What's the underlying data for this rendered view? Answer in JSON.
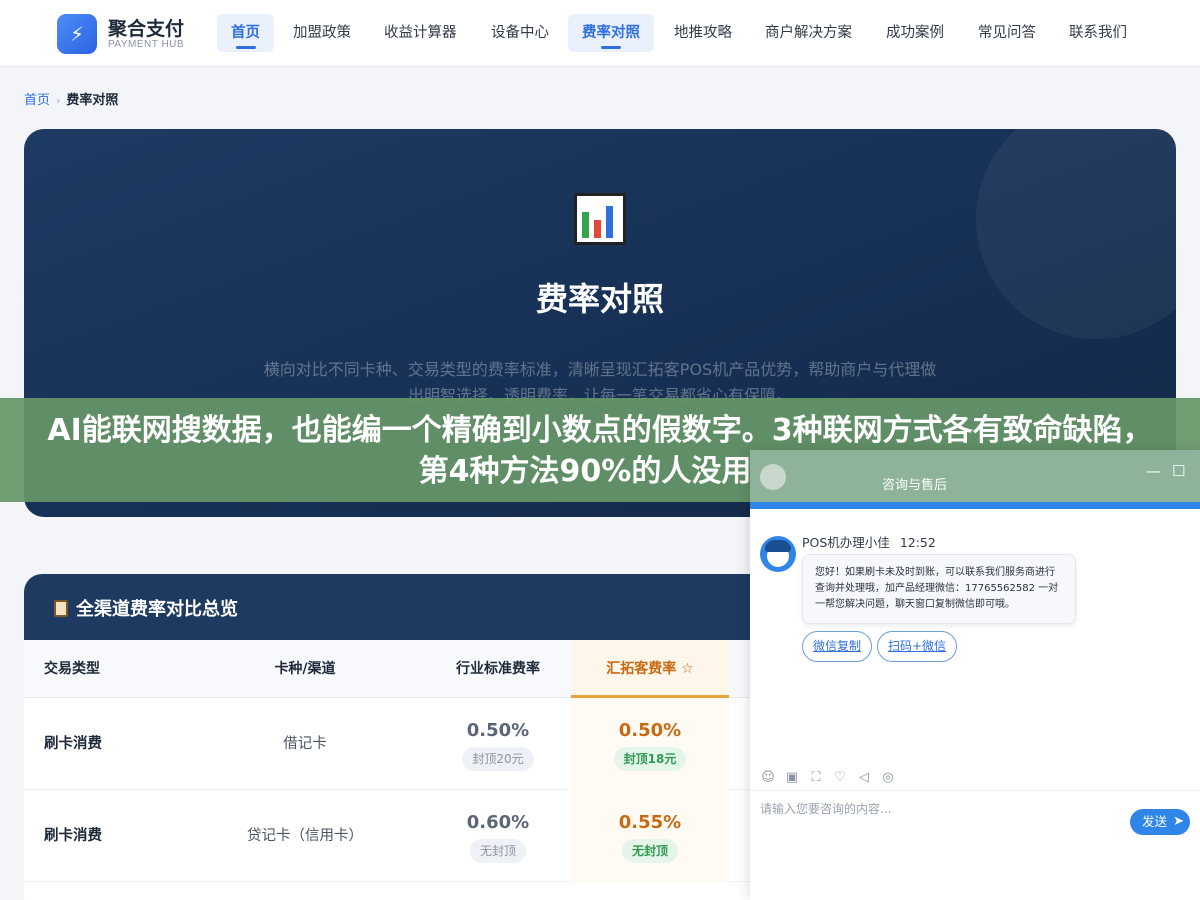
{
  "header": {
    "logo_icon": "lightning-icon",
    "logo_name": "聚合支付",
    "logo_sub": "PAYMENT HUB",
    "nav": [
      {
        "label": "首页",
        "active": true
      },
      {
        "label": "加盟政策"
      },
      {
        "label": "收益计算器"
      },
      {
        "label": "设备中心"
      },
      {
        "label": "费率对照",
        "active": true
      },
      {
        "label": "地推攻略"
      },
      {
        "label": "商户解决方案"
      },
      {
        "label": "成功案例"
      },
      {
        "label": "常见问答"
      },
      {
        "label": "联系我们"
      }
    ]
  },
  "breadcrumb": {
    "home": "首页",
    "current": "费率对照"
  },
  "hero": {
    "icon": "bar-chart-icon",
    "title": "费率对照",
    "desc": "横向对比不同卡种、交易类型的费率标准，清晰呈现汇拓客POS机产品优势，帮助商户与代理做出明智选择。透明费率，让每一笔交易都省心有保障。"
  },
  "banner": {
    "text": "AI能联网搜数据，也能编一个精确到小数点的假数字。3种联网方式各有致命缺陷，第4种方法90%的人没用过"
  },
  "table": {
    "title": "全渠道费率对比总览",
    "title_icon": "clipboard-icon",
    "headers": [
      "交易类型",
      "卡种/渠道",
      "行业标准费率",
      "汇拓客费率 ☆"
    ],
    "rows": [
      {
        "type": "刷卡消费",
        "card": "借记卡",
        "std_rate": "0.50%",
        "std_note": "封顶20元",
        "hl_rate": "0.50%",
        "hl_note": "封顶18元"
      },
      {
        "type": "刷卡消费",
        "card": "贷记卡（信用卡）",
        "std_rate": "0.60%",
        "std_note": "无封顶",
        "hl_rate": "0.55%",
        "hl_note": "无封顶"
      }
    ]
  },
  "chat": {
    "window_title": "咨询与售后",
    "agent_name": "POS机办理小佳",
    "time": "12:52",
    "message": "您好！如果刷卡未及时到账，可以联系我们服务商进行查询并处理哦，加产品经理微信：17765562582 一对一帮您解决问题，聊天窗口复制微信即可哦。",
    "buttons": [
      "微信复制",
      "扫码+微信"
    ],
    "placeholder": "请输入您要咨询的内容...",
    "send_label": "发送",
    "tools": [
      "emoji-icon",
      "image-icon",
      "screenshot-icon",
      "rating-icon",
      "voice-icon",
      "wechat-icon"
    ]
  }
}
